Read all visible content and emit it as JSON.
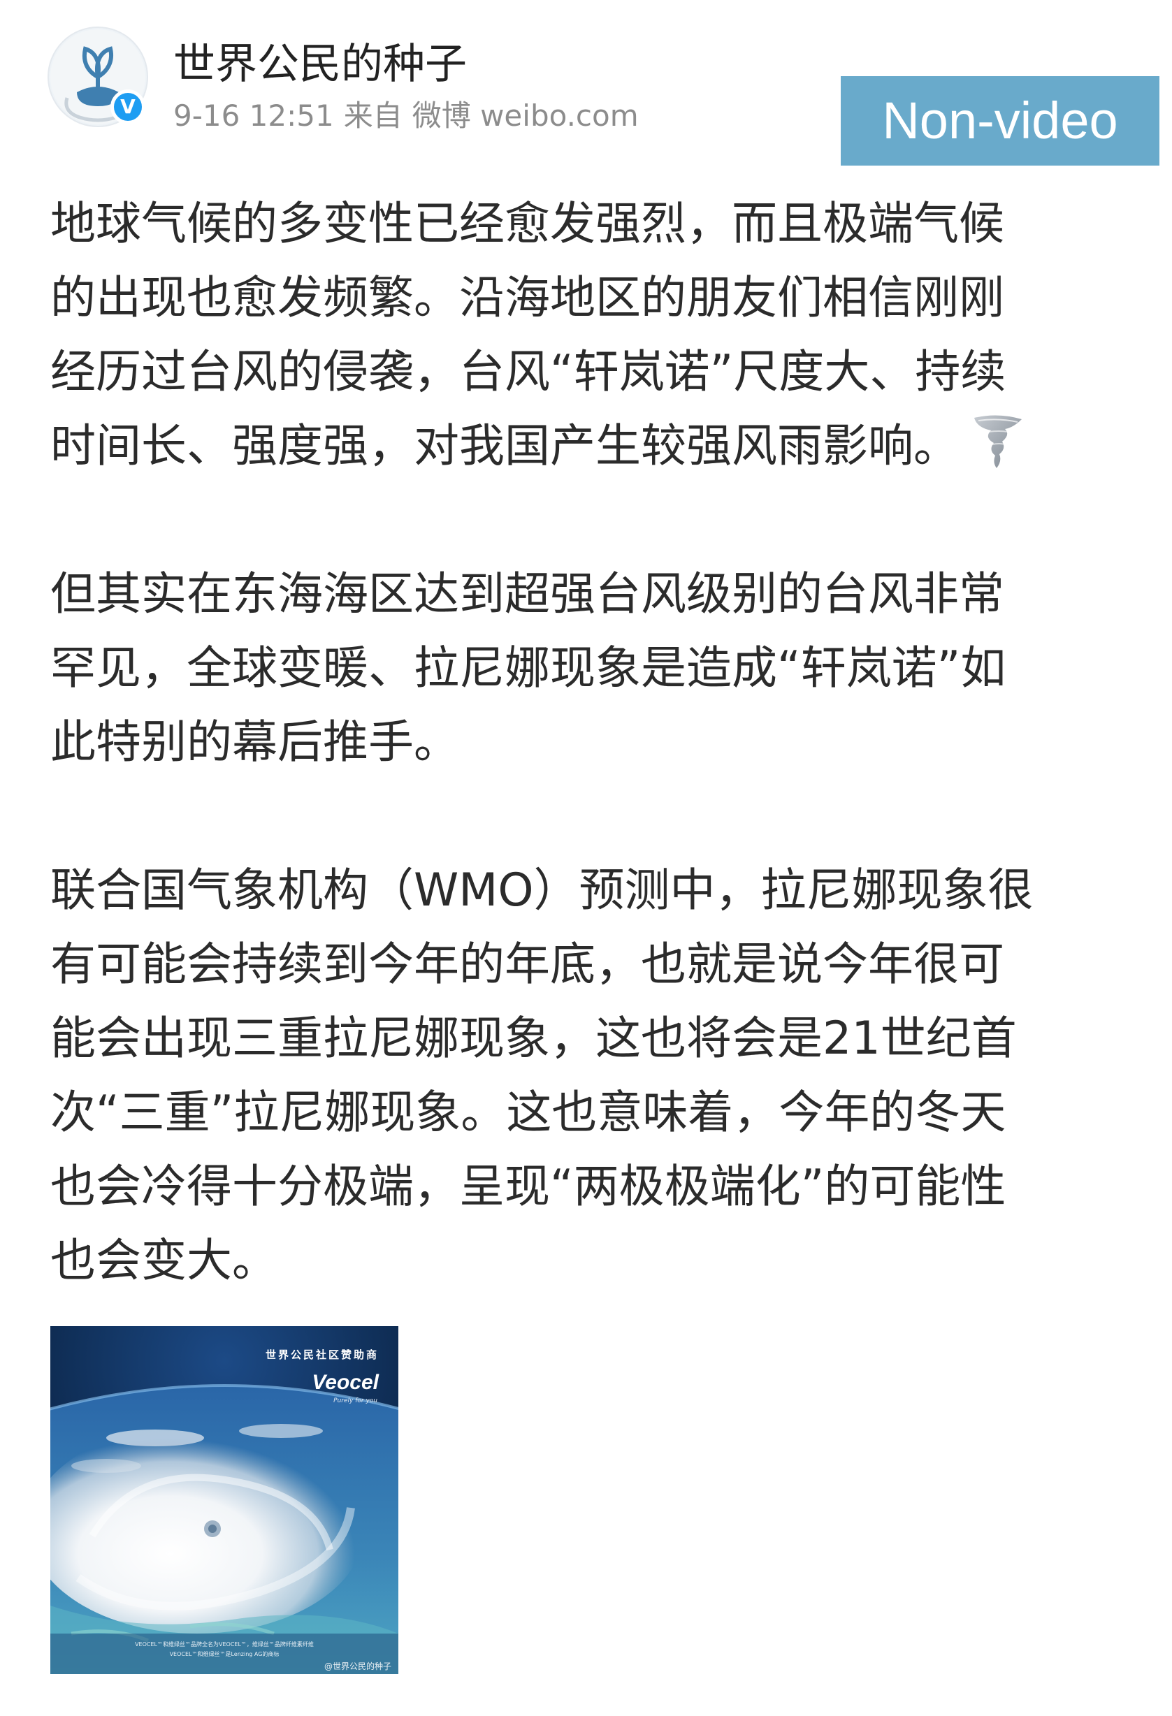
{
  "header": {
    "account_name": "世界公民的种子",
    "post_time": "9-16 12:51",
    "source_prefix": "来自",
    "source": "微博 weibo.com",
    "verified_mark": "V",
    "tag": "Non-video"
  },
  "post": {
    "paragraphs": [
      {
        "lines": [
          "地球气候的多变性已经愈发强烈，而且极端气候",
          "的出现也愈发频繁。沿海地区的朋友们相信刚刚",
          "经历过台风的侵袭，台风“轩岚诺”尺度大、持续",
          "时间长、强度强，对我国产生较强风雨影响。"
        ],
        "trailing_emoji": "tornado-icon"
      },
      {
        "lines": [
          "但其实在东海海区达到超强台风级别的台风非常",
          "罕见，全球变暖、拉尼娜现象是造成“轩岚诺”如",
          "此特别的幕后推手。"
        ]
      },
      {
        "lines": [
          "联合国气象机构（WMO）预测中，拉尼娜现象很",
          "有可能会持续到今年的年底，也就是说今年很可",
          "能会出现三重拉尼娜现象，这也将会是21世纪首",
          "次“三重”拉尼娜现象。这也意味着，今年的冬天",
          "也会冷得十分极端，呈现“两极极端化”的可能性",
          "也会变大。"
        ]
      }
    ]
  },
  "image": {
    "subject": "typhoon-from-space-photo",
    "sponsor": "世界公民社区赞助商",
    "brand": "Veocel",
    "brand_tagline": "Purely for you",
    "fine_print_1": "VEOCEL™和维绿丝™品牌全名为VEOCEL™，维绿丝™品牌纤维素纤维",
    "fine_print_2": "VEOCEL™和维绿丝™是Lenzing AG的商标",
    "watermark": "@世界公民的种子"
  },
  "colors": {
    "tag_background": "#69aacb",
    "verified_blue": "#1e9df2",
    "body_text": "#2b2b2b",
    "meta_text": "#8c8c8c"
  }
}
